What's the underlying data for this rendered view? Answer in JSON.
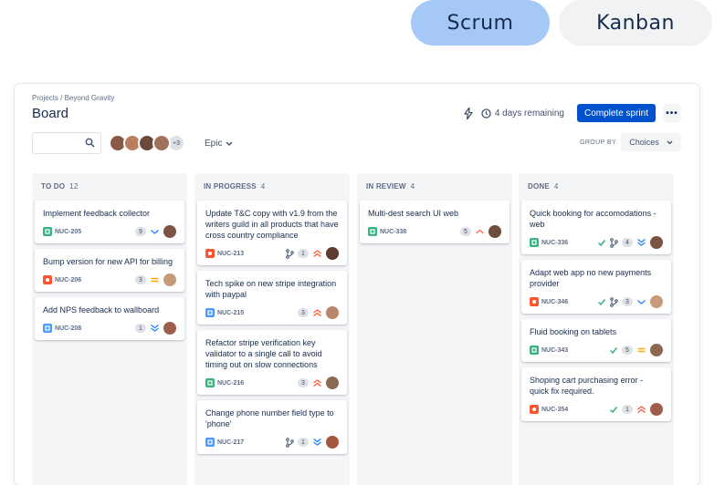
{
  "toggle": {
    "scrum": "Scrum",
    "kanban": "Kanban"
  },
  "breadcrumb": "Projects / Beyond Gravity",
  "title": "Board",
  "header": {
    "days_remaining": "4 days remaining",
    "complete_label": "Complete sprint",
    "more_label": "•••"
  },
  "filters": {
    "avatar_more": "+3",
    "epic_label": "Epic",
    "group_by_label": "GROUP BY",
    "group_by_value": "Choices"
  },
  "colors": {
    "accent": "#0052cc",
    "story": "#36b37e",
    "bug": "#ff5630",
    "task": "#4c9aff"
  },
  "columns": [
    {
      "name": "TO DO",
      "count": "12",
      "cards": [
        {
          "title": "Implement feedback collector",
          "key": "NUC-205",
          "type": "story",
          "est": "9",
          "priority": "low",
          "avatar": 0
        },
        {
          "title": "Bump version for new API for billing",
          "key": "NUC-206",
          "type": "bug",
          "est": "3",
          "priority": "medium",
          "avatar": 1
        },
        {
          "title": "Add NPS feedback to wallboard",
          "key": "NUC-208",
          "type": "task",
          "est": "1",
          "priority": "lowest",
          "avatar": 2
        }
      ]
    },
    {
      "name": "IN PROGRESS",
      "count": "4",
      "cards": [
        {
          "title": "Update T&C copy with v1.9 from the writers guild in all products that have cross country compliance",
          "key": "NUC-213",
          "type": "bug",
          "est": "1",
          "priority": "highest",
          "branch": true,
          "avatar": 3
        },
        {
          "title": "Tech spike on new stripe integration with paypal",
          "key": "NUC-215",
          "type": "task",
          "est": "3",
          "priority": "highest",
          "avatar": 4
        },
        {
          "title": "Refactor stripe verification key validator to a single call to avoid timing out on slow connections",
          "key": "NUC-216",
          "type": "story",
          "est": "3",
          "priority": "highest",
          "avatar": 5
        },
        {
          "title": "Change phone number field type to 'phone'",
          "key": "NUC-217",
          "type": "task",
          "est": "1",
          "priority": "lowest",
          "pr": true,
          "avatar": 6
        }
      ]
    },
    {
      "name": "IN REVIEW",
      "count": "4",
      "cards": [
        {
          "title": "Multi-dest search UI web",
          "key": "NUC-338",
          "type": "story",
          "est": "5",
          "priority": "high",
          "avatar": 7
        }
      ]
    },
    {
      "name": "DONE",
      "count": "4",
      "cards": [
        {
          "title": "Quick booking for accomodations - web",
          "key": "NUC-336",
          "type": "story",
          "est": "4",
          "priority": "lowest",
          "check": true,
          "pr": true,
          "avatar": 0
        },
        {
          "title": "Adapt web app no new payments provider",
          "key": "NUC-346",
          "type": "bug",
          "est": "3",
          "priority": "low",
          "check": true,
          "pr": true,
          "avatar": 1
        },
        {
          "title": "Fluid booking on tablets",
          "key": "NUC-343",
          "type": "story",
          "est": "5",
          "priority": "medium",
          "check": true,
          "avatar": 5
        },
        {
          "title": "Shoping cart purchasing error - quick fix required.",
          "key": "NUC-354",
          "type": "bug",
          "est": "1",
          "priority": "highest",
          "check": true,
          "avatar": 2
        }
      ]
    }
  ]
}
